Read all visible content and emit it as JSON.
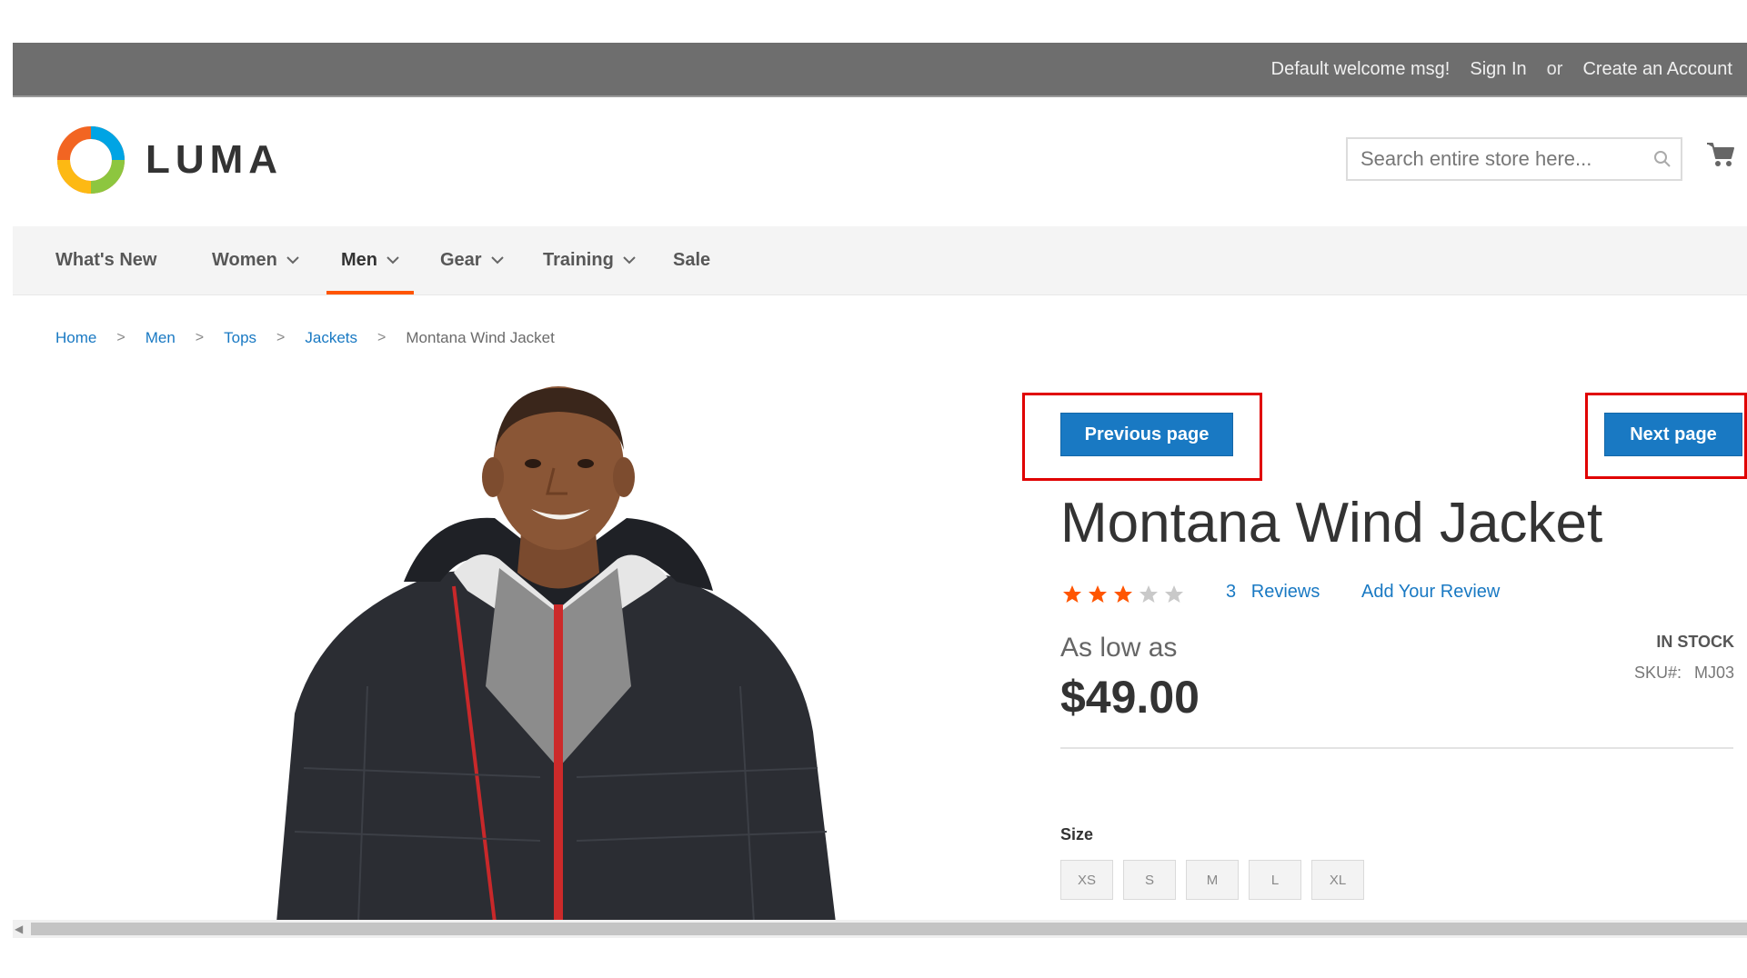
{
  "header": {
    "welcome": "Default welcome msg!",
    "sign_in": "Sign In",
    "or": "or",
    "create_account": "Create an Account",
    "logo_text": "LUMA",
    "search_placeholder": "Search entire store here...",
    "icons": {
      "search": "search-icon",
      "cart": "cart-icon"
    }
  },
  "nav": {
    "items": [
      {
        "label": "What's New",
        "dropdown": false
      },
      {
        "label": "Women",
        "dropdown": true
      },
      {
        "label": "Men",
        "dropdown": true,
        "active": true
      },
      {
        "label": "Gear",
        "dropdown": true
      },
      {
        "label": "Training",
        "dropdown": true
      },
      {
        "label": "Sale",
        "dropdown": false
      }
    ],
    "active_color": "#ff5501"
  },
  "breadcrumb": {
    "items": [
      "Home",
      "Men",
      "Tops",
      "Jackets"
    ],
    "current": "Montana Wind Jacket",
    "separator": ">"
  },
  "pagination": {
    "previous_label": "Previous page",
    "next_label": "Next page",
    "highlight_color": "#e00000",
    "button_color": "#1979c3"
  },
  "product": {
    "name": "Montana Wind Jacket",
    "rating": {
      "value": 3,
      "max": 5,
      "color": "#ff5501"
    },
    "reviews_count": "3",
    "reviews_label": "Reviews",
    "add_review": "Add Your Review",
    "price_label": "As low as",
    "price": "$49.00",
    "stock": "IN STOCK",
    "sku_label": "SKU#:",
    "sku": "MJ03",
    "size_label": "Size",
    "sizes": [
      "XS",
      "S",
      "M",
      "L",
      "XL"
    ]
  }
}
